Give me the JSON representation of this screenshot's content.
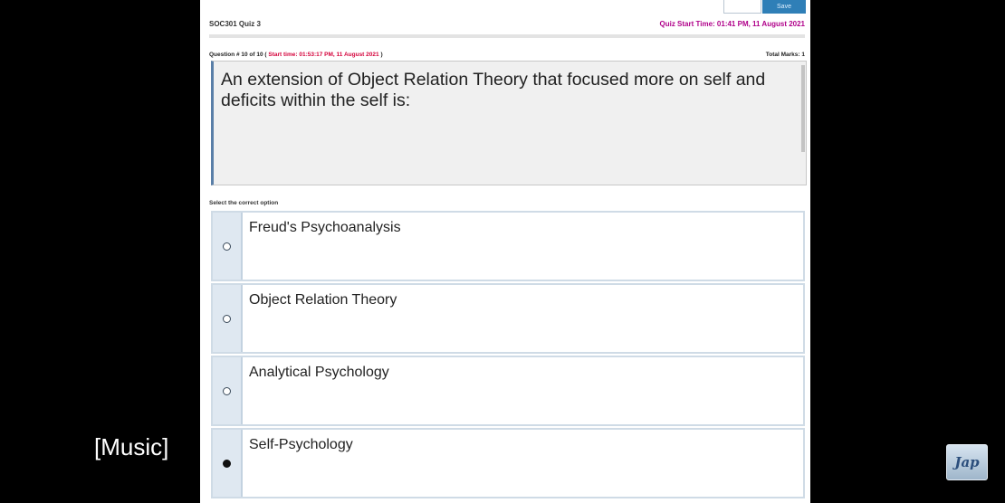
{
  "quiz": {
    "title": "SOC301 Quiz 3",
    "start_time": "Quiz Start Time: 01:41 PM, 11 August 2021"
  },
  "question": {
    "number_label": "Question # 10 of 10 (",
    "start_time": "Start time: 01:53:17 PM, 11 August 2021",
    "close_paren": ")",
    "total_marks": "Total Marks: 1",
    "text": "An extension of Object Relation Theory that focused more on self and deficits within the self is:"
  },
  "instruction": "Select the correct option",
  "options": [
    {
      "label": "Freud's Psychoanalysis",
      "selected": false
    },
    {
      "label": "Object Relation Theory",
      "selected": false
    },
    {
      "label": "Analytical Psychology",
      "selected": false
    },
    {
      "label": "Self-Psychology",
      "selected": true
    }
  ],
  "top_button": "Save",
  "caption": "[Music]",
  "logo_text": "Jap"
}
